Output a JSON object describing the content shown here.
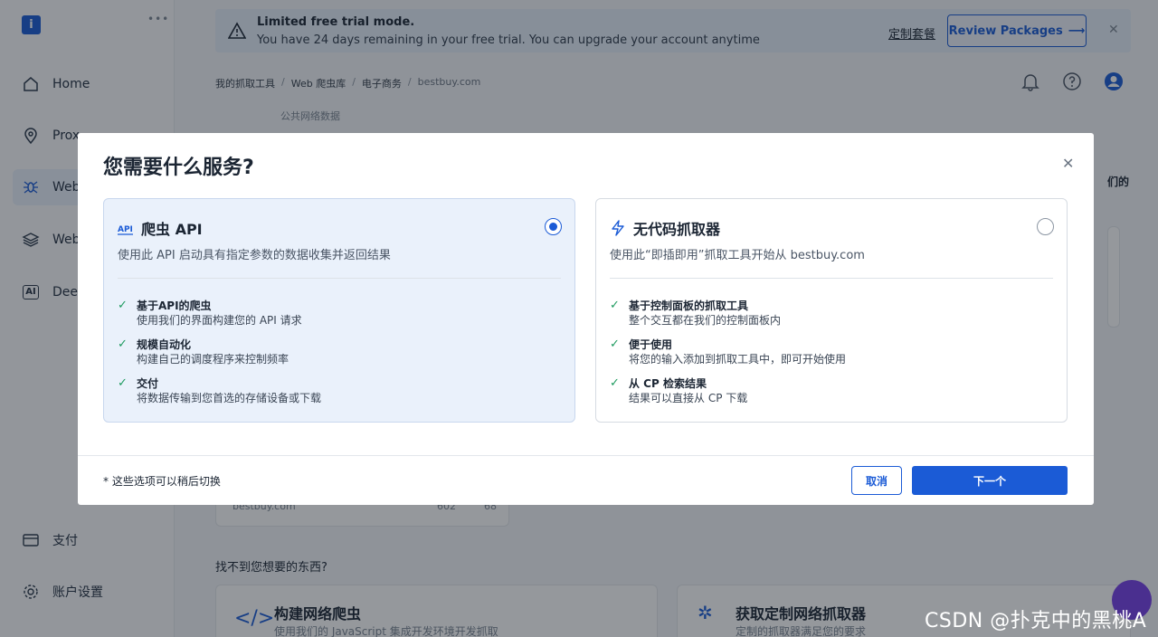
{
  "sidebar": {
    "items": [
      {
        "label": "Home",
        "icon": "home-icon"
      },
      {
        "label": "Prox",
        "icon": "location-pin-icon"
      },
      {
        "label": "Web",
        "icon": "spider-icon"
      },
      {
        "label": "Web",
        "icon": "layers-icon"
      },
      {
        "label": "Deep",
        "icon": "ai-icon"
      }
    ],
    "bottom": [
      {
        "label": "支付",
        "icon": "card-icon"
      },
      {
        "label": "账户设置",
        "icon": "gear-icon"
      }
    ]
  },
  "trial": {
    "title": "Limited free trial mode.",
    "message": "You have 24 days remaining in your free trial. You can upgrade your account anytime",
    "link": "定制套餐",
    "review_button": "Review Packages"
  },
  "breadcrumb": [
    "我的抓取工具",
    "Web 爬虫库",
    "电子商务",
    "bestbuy.com"
  ],
  "background": {
    "bestbuy": "bestbuy.com",
    "views": "602",
    "downloads": "68",
    "not_found": "找不到您想要的东西?",
    "build_title": "构建网络爬虫",
    "build_desc": "使用我们的 JavaScript 集成开发环境开发抓取",
    "custom_title": "获取定制网络抓取器",
    "custom_desc": "定制的抓取器满足您的要求",
    "right_snippet": "们的",
    "public_data": "公共网络数据"
  },
  "modal": {
    "title": "您需要什么服务?",
    "options": [
      {
        "name": "爬虫 API",
        "desc": "使用此 API 启动具有指定参数的数据收集并返回结果",
        "selected": true,
        "features": [
          {
            "title": "基于API的爬虫",
            "desc": "使用我们的界面构建您的 API 请求"
          },
          {
            "title": "规模自动化",
            "desc": "构建自己的调度程序来控制频率"
          },
          {
            "title": "交付",
            "desc": "将数据传输到您首选的存储设备或下载"
          }
        ]
      },
      {
        "name": "无代码抓取器",
        "desc": "使用此“即插即用”抓取工具开始从 bestbuy.com",
        "selected": false,
        "features": [
          {
            "title": "基于控制面板的抓取工具",
            "desc": "整个交互都在我们的控制面板内"
          },
          {
            "title": "便于使用",
            "desc": "将您的输入添加到抓取工具中，即可开始使用"
          },
          {
            "title": "从 CP 检索结果",
            "desc": "结果可以直接从 CP 下载"
          }
        ]
      }
    ],
    "note": "* 这些选项可以稍后切换",
    "cancel": "取消",
    "next": "下一个"
  },
  "watermark": "CSDN @扑克中的黑桃A",
  "colors": {
    "primary": "#1b5bd6",
    "check": "#1e9b5f",
    "selected_bg": "#eaf1fb"
  }
}
